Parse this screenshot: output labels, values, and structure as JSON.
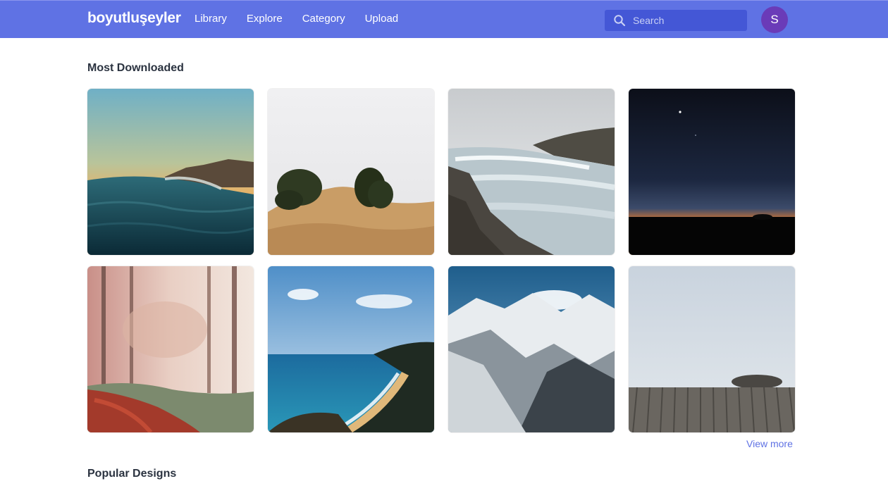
{
  "header": {
    "brand": "boyutluşeyler",
    "nav": [
      "Library",
      "Explore",
      "Category",
      "Upload"
    ],
    "search": {
      "placeholder": "Search",
      "value": ""
    },
    "avatar_initial": "S",
    "bar_color": "#5f72e4",
    "avatar_color": "#6a3bb8"
  },
  "main": {
    "most_downloaded": {
      "title": "Most Downloaded",
      "images": [
        "ocean-wave-sunset",
        "foggy-cliff-trees",
        "waterfall-river",
        "night-sky-horizon",
        "autumn-forest-path",
        "coastline-beach",
        "snowy-mountain-range",
        "foggy-wooden-deck"
      ],
      "view_more": "View more"
    },
    "popular_designs": {
      "title": "Popular Designs"
    }
  }
}
